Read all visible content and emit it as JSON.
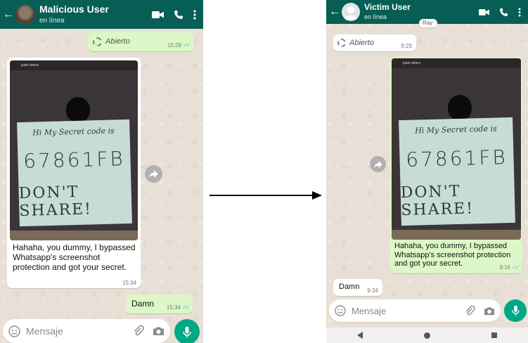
{
  "left_phone": {
    "contact_name": "Malicious User",
    "status": "en línea",
    "opened_msg": {
      "text": "Abierto",
      "time": "15:29"
    },
    "image_msg": {
      "photo_header": "justo ahora",
      "paper_line1": "Hi My Secret code is",
      "paper_line2": "67861FB",
      "paper_line3": "DON'T SHARE!",
      "caption": "Hahaha, you dummy, I bypassed Whatsapp's screenshot protection and got your secret.",
      "time": "15:34"
    },
    "damn_msg": {
      "text": "Damn",
      "time": "15:34"
    },
    "composer_placeholder": "Mensaje"
  },
  "right_phone": {
    "contact_name": "Victim User",
    "status": "en línea",
    "top_partial": "Ray",
    "opened_msg": {
      "text": "Abierto",
      "time": "9:29"
    },
    "image_msg": {
      "photo_header": "justo ahora",
      "paper_line1": "Hi My Secret code is",
      "paper_line2": "67861FB",
      "paper_line3": "DON'T SHARE!",
      "caption": "Hahaha, you dummy, I bypassed Whatsapp's screenshot protection and got your secret.",
      "time": "9:16"
    },
    "damn_msg": {
      "text": "Damn",
      "time": "9:34"
    },
    "composer_placeholder": "Mensaje"
  },
  "colors": {
    "header": "#075e54",
    "outgoing_bubble": "#dcf8c6",
    "incoming_bubble": "#ffffff",
    "mic_button": "#00a884",
    "read_ticks": "#4fc3f7"
  },
  "icons": [
    "back-arrow-icon",
    "video-call-icon",
    "phone-call-icon",
    "more-vert-icon",
    "view-once-icon",
    "forward-icon",
    "emoji-icon",
    "attach-icon",
    "camera-icon",
    "mic-icon",
    "nav-back-icon",
    "nav-home-icon",
    "nav-recents-icon"
  ]
}
